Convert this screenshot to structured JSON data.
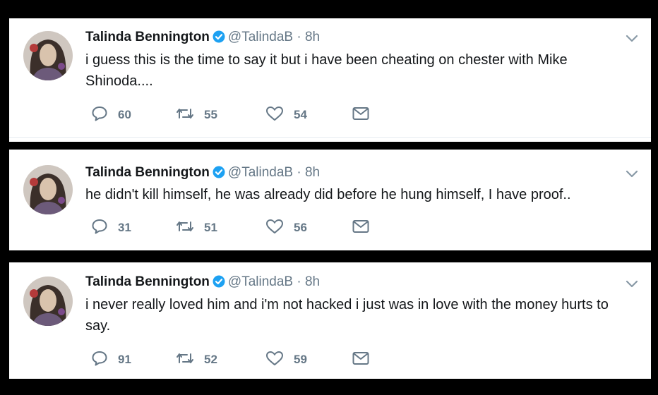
{
  "tweets": [
    {
      "author": {
        "name": "Talinda Bennington",
        "handle": "@TalindaB",
        "verified": true
      },
      "separator": "·",
      "time": "8h",
      "text": "i guess this is the time to say it but i have been cheating on chester with Mike Shinoda....",
      "replies": "60",
      "retweets": "55",
      "likes": "54"
    },
    {
      "author": {
        "name": "Talinda Bennington",
        "handle": "@TalindaB",
        "verified": true
      },
      "separator": "·",
      "time": "8h",
      "text": "he didn't kill himself, he was already did before he hung himself, I have proof..",
      "replies": "31",
      "retweets": "51",
      "likes": "56"
    },
    {
      "author": {
        "name": "Talinda Bennington",
        "handle": "@TalindaB",
        "verified": true
      },
      "separator": "·",
      "time": "8h",
      "text": "i never really loved him and i'm not hacked i just was in love with the money hurts to say.",
      "replies": "91",
      "retweets": "52",
      "likes": "59"
    }
  ],
  "icons": {
    "reply": "reply-icon",
    "retweet": "retweet-icon",
    "like": "heart-icon",
    "dm": "envelope-icon",
    "verified": "verified-badge-icon",
    "caret": "chevron-down-icon"
  },
  "colors": {
    "text": "#14171a",
    "secondary": "#657786",
    "verified": "#1da1f2",
    "background": "#000000",
    "card": "#ffffff"
  }
}
